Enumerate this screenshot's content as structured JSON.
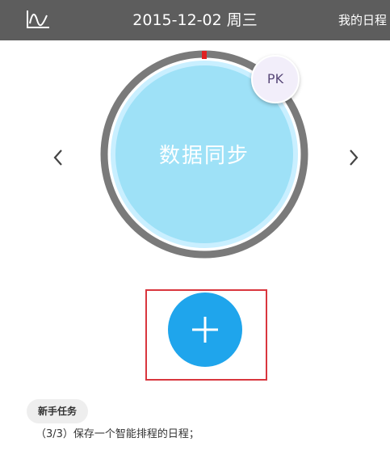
{
  "header": {
    "date": "2015-12-02 周三",
    "right_link": "我的日程",
    "left_icon": "line-chart-icon"
  },
  "main": {
    "sync_label": "数据同步",
    "avatar_label": "PK",
    "prev_icon": "chevron-left-icon",
    "next_icon": "chevron-right-icon",
    "add_icon": "plus-icon"
  },
  "task": {
    "badge": "新手任务",
    "text": "（3/3）保存一个智能排程的日程；"
  },
  "colors": {
    "topbar": "#5d5d5d",
    "ring": "#7a7a7a",
    "ring_marker": "#e02020",
    "circle_fill": "#9ee1f7",
    "add_button": "#1fa5ec",
    "highlight": "#d9363e"
  }
}
